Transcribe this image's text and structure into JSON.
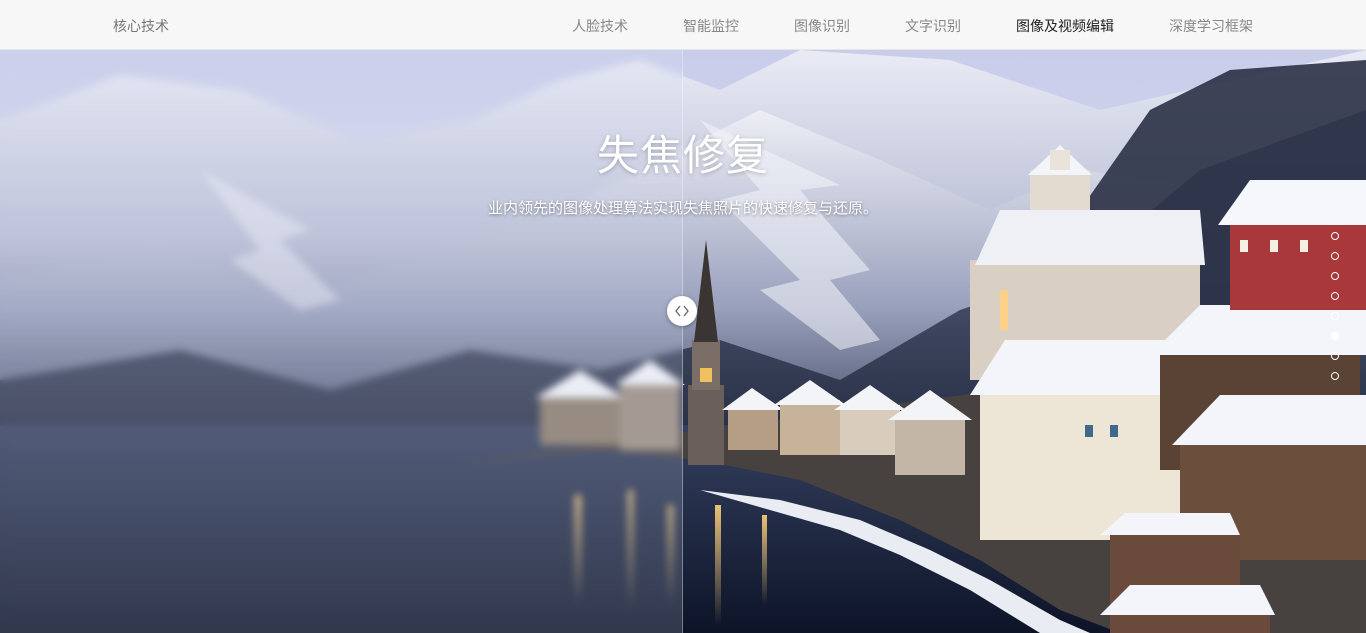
{
  "header": {
    "brand_label": "核心技术",
    "nav_items": [
      {
        "label": "人脸技术",
        "active": false
      },
      {
        "label": "智能监控",
        "active": false
      },
      {
        "label": "图像识别",
        "active": false
      },
      {
        "label": "文字识别",
        "active": false
      },
      {
        "label": "图像及视频编辑",
        "active": true
      },
      {
        "label": "深度学习框架",
        "active": false
      }
    ]
  },
  "hero": {
    "title": "失焦修复",
    "subtitle": "业内领先的图像处理算法实现失焦照片的快速修复与还原。",
    "compare_handle_icon": "chevron-left-right-icon",
    "slide_count": 8,
    "active_slide": 5
  },
  "colors": {
    "nav_background": "#f7f7f7",
    "nav_text": "#888888",
    "nav_active_text": "#222222",
    "hero_text": "#ffffff"
  }
}
